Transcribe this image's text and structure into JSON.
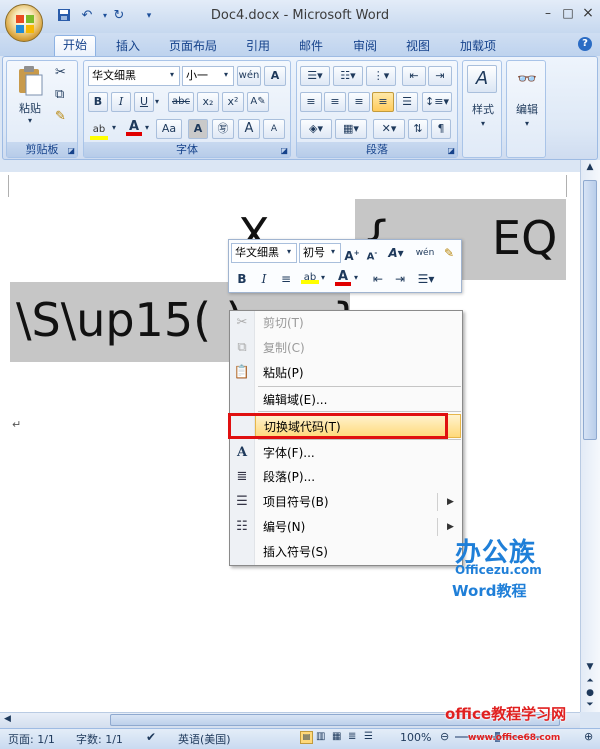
{
  "window": {
    "title": "Doc4.docx - Microsoft Word",
    "minimize": "–",
    "maximize": "□",
    "close": "×",
    "help": "?"
  },
  "tabs": [
    {
      "label": "开始",
      "active": true
    },
    {
      "label": "插入"
    },
    {
      "label": "页面布局"
    },
    {
      "label": "引用"
    },
    {
      "label": "邮件"
    },
    {
      "label": "审阅"
    },
    {
      "label": "视图"
    },
    {
      "label": "加载项"
    }
  ],
  "ribbon": {
    "clipboard": {
      "label": "剪贴板",
      "paste": "粘贴"
    },
    "font": {
      "label": "字体",
      "name": "华文细黑",
      "size": "小一",
      "bold": "B",
      "italic": "I",
      "underline": "U",
      "strike": "abc",
      "sub": "x₂",
      "sup": "x²",
      "grow": "A",
      "shrink": "A",
      "case": "Aa"
    },
    "paragraph": {
      "label": "段落"
    },
    "styles": {
      "label": "样式"
    },
    "editing": {
      "label": "编辑"
    }
  },
  "document": {
    "line1_x": "X",
    "line1_brace": "{",
    "line1_eq": "EQ",
    "line2": "\\S\\up15( )",
    "line2_close": "}",
    "para_mark": "↵"
  },
  "mini_toolbar": {
    "font": "华文细黑",
    "size": "初号"
  },
  "context_menu": [
    {
      "label": "剪切(T)",
      "icon": "scissors-icon",
      "disabled": true
    },
    {
      "label": "复制(C)",
      "icon": "copy-icon",
      "disabled": true
    },
    {
      "label": "粘贴(P)",
      "icon": "paste-icon"
    },
    {
      "label": "编辑域(E)..."
    },
    {
      "label": "切换域代码(T)",
      "highlighted": true
    },
    {
      "label": "字体(F)...",
      "icon": "font-icon"
    },
    {
      "label": "段落(P)...",
      "icon": "paragraph-icon"
    },
    {
      "label": "项目符号(B)",
      "icon": "bullets-icon",
      "submenu": true
    },
    {
      "label": "编号(N)",
      "icon": "numbering-icon",
      "submenu": true
    },
    {
      "label": "插入符号(S)"
    }
  ],
  "status": {
    "page": "页面: 1/1",
    "words": "字数: 1/1",
    "lang": "英语(美国)",
    "zoom": "100%"
  },
  "watermark": {
    "brand": "办公族",
    "site": "Officezu.com",
    "tutorial": "Word教程",
    "footer": "office教程学习网",
    "footer_url": "www.office68.com"
  },
  "colors": {
    "highlight_border": "#e01010",
    "field_shading": "#c6c6c6"
  }
}
